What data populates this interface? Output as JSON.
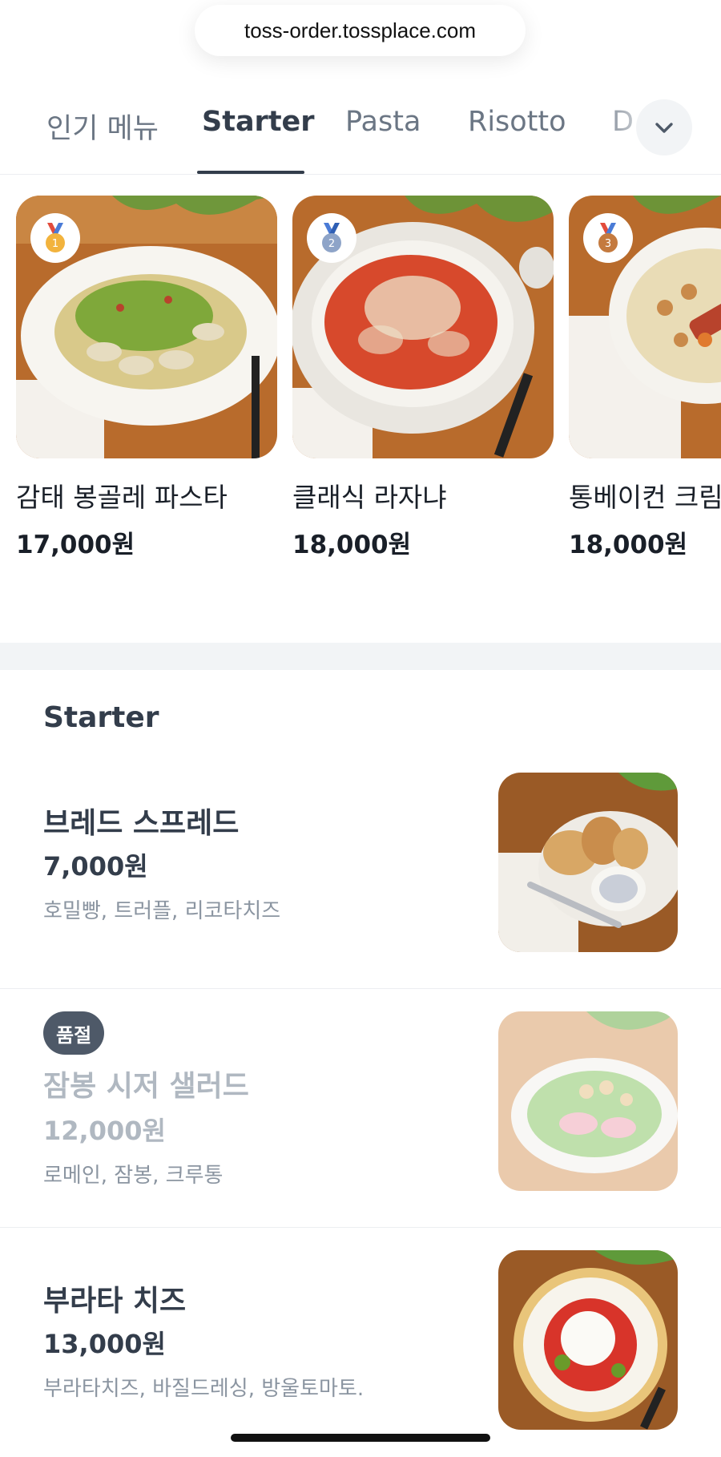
{
  "browser": {
    "url": "toss-order.tossplace.com"
  },
  "tabs": [
    {
      "label": "인기 메뉴"
    },
    {
      "label": "Starter"
    },
    {
      "label": "Pasta"
    },
    {
      "label": "Risotto"
    },
    {
      "label": "D"
    }
  ],
  "active_tab": "Starter",
  "popular": [
    {
      "rank": "1",
      "name": "감태 봉골레 파스타",
      "price": "17,000원",
      "medal_color": "#f2b33d"
    },
    {
      "rank": "2",
      "name": "클래식 라자냐",
      "price": "18,000원",
      "medal_color": "#8ea4c8"
    },
    {
      "rank": "3",
      "name": "통베이컨 크림",
      "price": "18,000원",
      "medal_color": "#c47a3f"
    }
  ],
  "section": {
    "title": "Starter"
  },
  "menu": [
    {
      "name": "브레드 스프레드",
      "price": "7,000원",
      "desc": "호밀빵, 트러플, 리코타치즈",
      "badge": ""
    },
    {
      "name": "잠봉 시저 샐러드",
      "price": "12,000원",
      "desc": "로메인, 잠봉, 크루통",
      "badge": "품절"
    },
    {
      "name": "부라타 치즈",
      "price": "13,000원",
      "desc": "부라타치즈, 바질드레싱, 방울토마토.",
      "badge": ""
    }
  ],
  "icons": {
    "tab_expand": "chevron-down-icon",
    "medal": "medal-icon"
  },
  "colors": {
    "text_primary": "#333d4b",
    "text_secondary": "#6b7684",
    "text_muted": "#8b95a1",
    "soldout_badge": "#4e5968",
    "divider_band": "#f2f4f6"
  }
}
